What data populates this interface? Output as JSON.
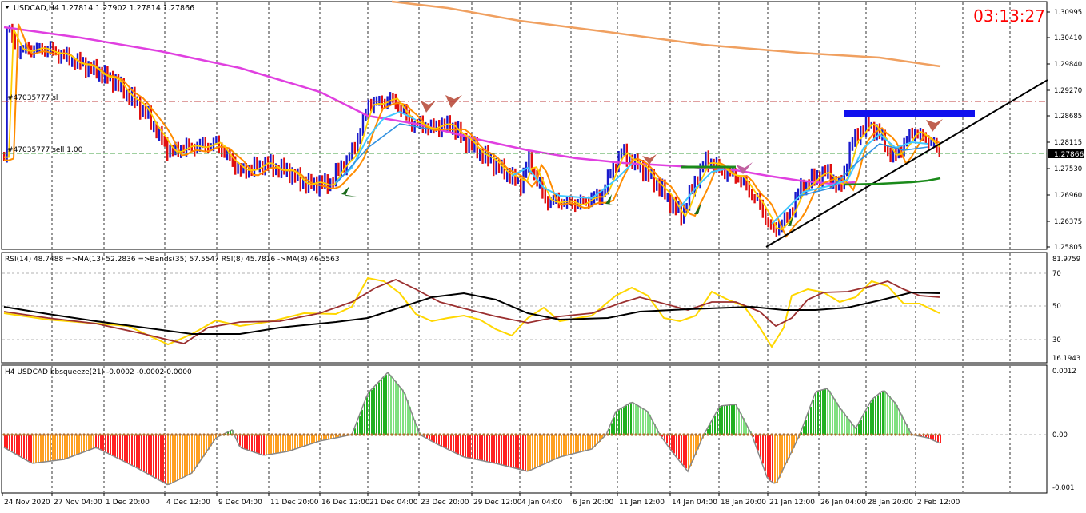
{
  "main": {
    "title": "USDCAD,H4  1.27814 1.27902 1.27814 1.27866",
    "timer": "03:13:27",
    "price_ticks": [
      "1.30995",
      "1.30410",
      "1.29840",
      "1.29270",
      "1.28685",
      "1.28115",
      "1.27530",
      "1.26960",
      "1.26375",
      "1.25805"
    ],
    "current_price": "1.27866",
    "sl_label": "#47035777 sl",
    "order_label": "#47035777 sell 1.00"
  },
  "rsi": {
    "label": "RSI(14) 48.7488  =>MA(13) 52.2836  =>Bands(35) 57.5547  RSI(8) 45.7816  ->MA(8) 46.5563",
    "ticks": [
      "81.9759",
      "70",
      "50",
      "30",
      "16.1943"
    ]
  },
  "squeeze": {
    "label": "H4 USDCAD bbsqueeze(21) -0.0002 -0.0002 0.0000",
    "ticks": [
      "0.0012",
      "0.00",
      "-0.001"
    ]
  },
  "time_axis": [
    "24 Nov 2020",
    "27 Nov 04:00",
    "1 Dec 20:00",
    "4 Dec 12:00",
    "9 Dec 04:00",
    "11 Dec 20:00",
    "16 Dec 12:00",
    "21 Dec 04:00",
    "23 Dec 20:00",
    "29 Dec 12:00",
    "4 Jan 04:00",
    "6 Jan 20:00",
    "11 Jan 12:00",
    "14 Jan 04:00",
    "18 Jan 20:00",
    "21 Jan 12:00",
    "26 Jan 04:00",
    "28 Jan 20:00",
    "2 Feb 12:00"
  ],
  "colors": {
    "bull_bar": "#1a1acc",
    "bear_bar": "#e01010",
    "ma_magenta": "#e040e0",
    "ma_salmon": "#f0a060",
    "ma_orange": "#ff8c00",
    "ma_yellow": "#ffcc00",
    "ma_lightblue": "#40c8ff",
    "ma_blue": "#3090e0",
    "squeeze_green": "#20b020",
    "squeeze_red": "#ff2020",
    "squeeze_orange": "#ffa020",
    "rsi_yellow": "#ffd700",
    "rsi_brown": "#9b3030",
    "timer_red": "#ff0000"
  }
}
